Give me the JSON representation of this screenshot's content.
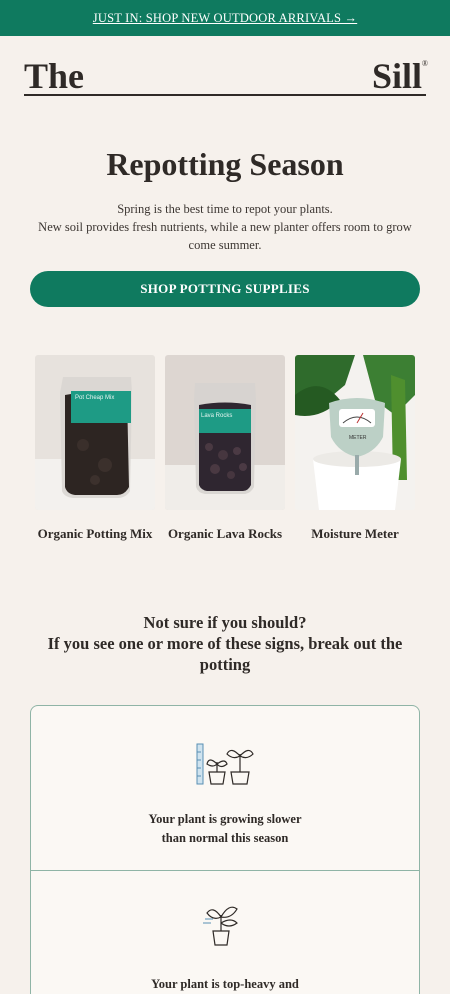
{
  "banner": {
    "text": "JUST IN: SHOP NEW OUTDOOR ARRIVALS →"
  },
  "logo": {
    "left": "The",
    "right": "Sill",
    "mark": "®"
  },
  "hero": {
    "title": "Repotting Season",
    "line1": "Spring is the best time to repot your plants.",
    "line2": "New soil provides fresh nutrients, while a new planter offers room to grow come summer."
  },
  "cta": {
    "label": "SHOP POTTING SUPPLIES"
  },
  "products": [
    {
      "name": "Organic Potting Mix",
      "bag_label": "Pot Cheap Mix",
      "icon": "soil-bag"
    },
    {
      "name": "Organic Lava Rocks",
      "bag_label": "Lava Rocks",
      "icon": "lava-rocks-bag"
    },
    {
      "name": "Moisture Meter",
      "meter_label": "METER",
      "icon": "moisture-meter"
    }
  ],
  "signs_intro": {
    "line1": "Not sure if you should?",
    "line2": "If you see one or more of these signs, break out the potting"
  },
  "signs": [
    {
      "text": "Your plant is growing slower than normal this season",
      "icon": "growth-ruler-icon"
    },
    {
      "text": "Your plant is top-heavy and",
      "icon": "top-heavy-plant-icon"
    }
  ],
  "colors": {
    "brand_green": "#0f7a5f",
    "background": "#f6f1ec",
    "text": "#2f2a27"
  }
}
